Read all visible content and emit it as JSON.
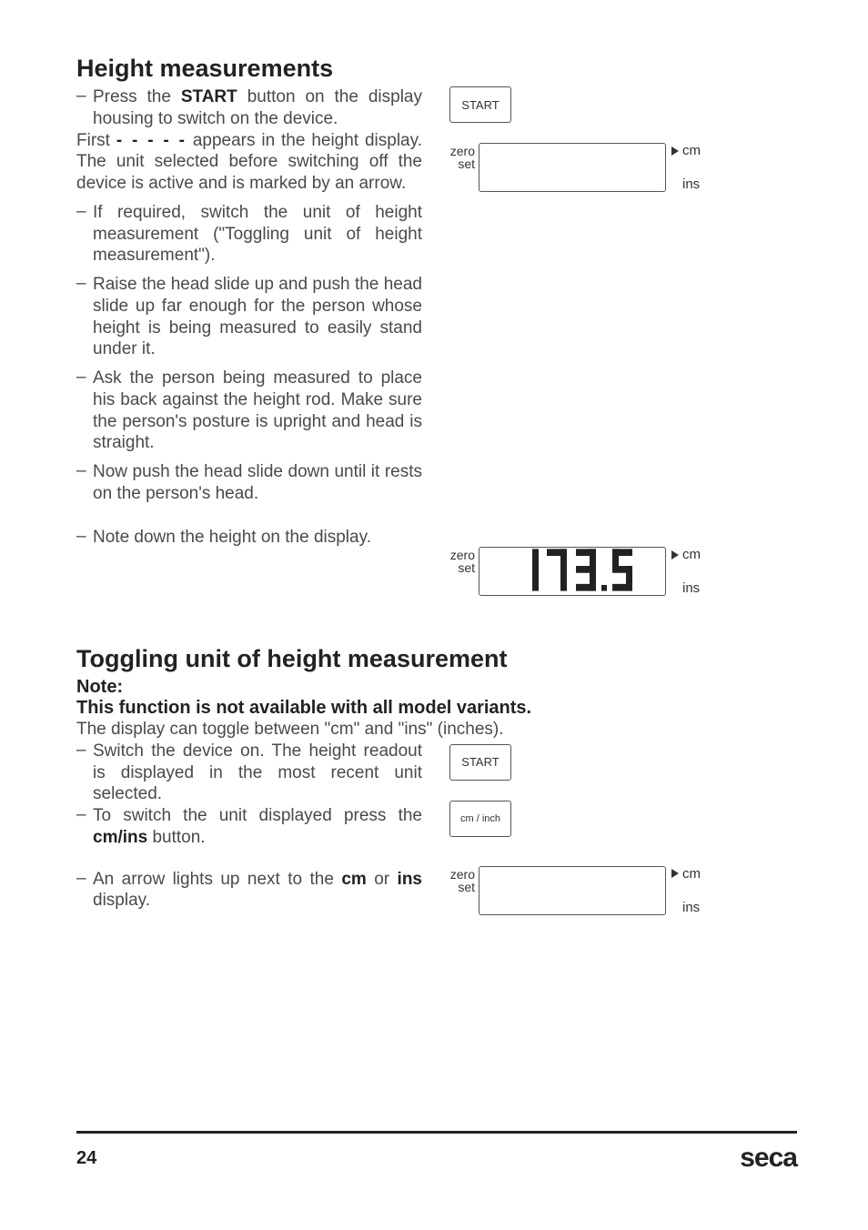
{
  "section1": {
    "title": "Height measurements",
    "bullet1_a": "Press the ",
    "bullet1_bold": "START",
    "bullet1_b": " button on the display housing to switch on the device.",
    "para1_a": "First ",
    "para1_dashes": "- - - - -",
    "para1_b": " appears in the height display. The unit selected before switching off the device is active and is marked by an arrow.",
    "bullet2": "If required, switch the unit of height measurement (\"Toggling unit of height measurement\").",
    "bullet3": "Raise the head slide up and push the head slide up far enough for the person whose height is being measured to easily stand under it.",
    "bullet4": "Ask the person being measured to place his back against the height rod. Make sure the person's posture is upright and head is straight.",
    "bullet5": "Now push the head slide down until it rests on the person's head.",
    "bullet6": "Note down the height on the display."
  },
  "section2": {
    "title": "Toggling unit of height measurement",
    "note_label": "Note:",
    "note_text": "This function is not available with all model variants.",
    "para1": "The display can toggle between \"cm\" and \"ins\" (inches).",
    "bullet1": "Switch the device on. The height readout is displayed in the most recent unit selected.",
    "bullet2_a": "To switch the unit displayed press the ",
    "bullet2_bold": "cm/ins",
    "bullet2_b": " button.",
    "bullet3_a": "An arrow lights up next to the ",
    "bullet3_bold1": "cm",
    "bullet3_mid": " or ",
    "bullet3_bold2": "ins",
    "bullet3_b": " display."
  },
  "display": {
    "zero": "zero",
    "set": "set",
    "cm": "cm",
    "ins": "ins",
    "start_btn": "START",
    "cm_btn": "cm / inch",
    "value": "173.5"
  },
  "footer": {
    "page": "24",
    "brand": "seca"
  }
}
